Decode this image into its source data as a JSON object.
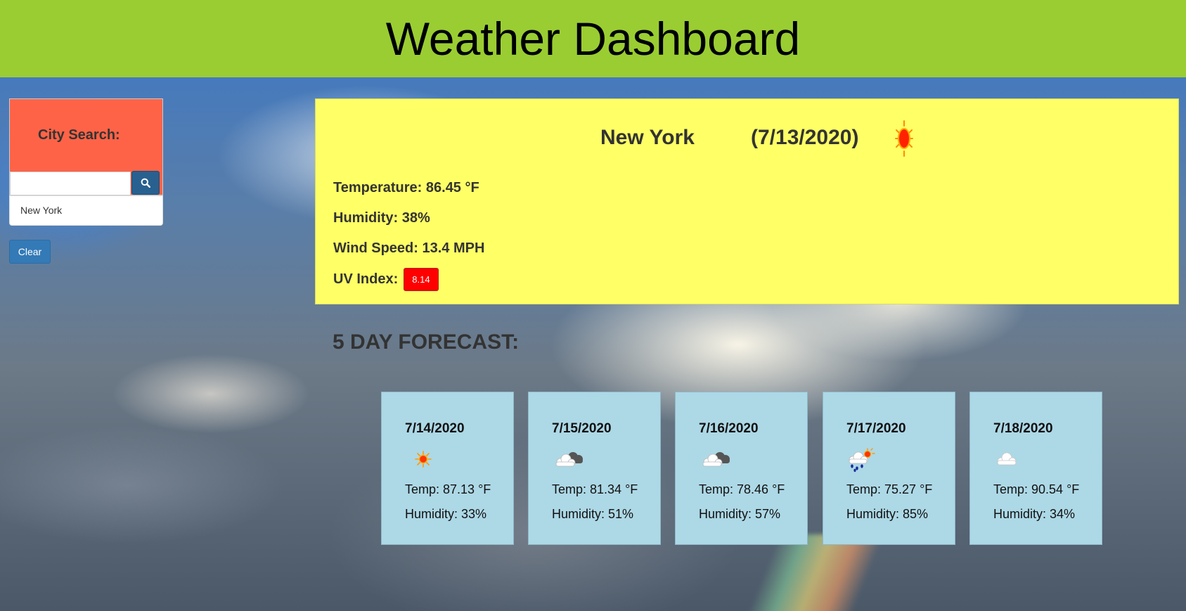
{
  "header": {
    "title": "Weather Dashboard"
  },
  "sidebar": {
    "search_label": "City Search:",
    "search_input_value": "",
    "search_button_icon": "search-icon",
    "history": [
      "New York"
    ],
    "clear_label": "Clear"
  },
  "current": {
    "city": "New York",
    "date": "(7/13/2020)",
    "icon": "sun-icon",
    "temperature": "Temperature: 86.45 °F",
    "humidity": "Humidity: 38%",
    "wind": "Wind Speed: 13.4 MPH",
    "uv_label": "UV Index:",
    "uv_value": "8.14",
    "uv_color": "#ff0000"
  },
  "forecast": {
    "heading": "5 DAY FORECAST:",
    "days": [
      {
        "date": "7/14/2020",
        "icon": "sun-icon",
        "temp": "Temp: 87.13 °F",
        "humidity": "Humidity: 33%"
      },
      {
        "date": "7/15/2020",
        "icon": "cloud-icon",
        "temp": "Temp: 81.34 °F",
        "humidity": "Humidity: 51%"
      },
      {
        "date": "7/16/2020",
        "icon": "cloud-icon",
        "temp": "Temp: 78.46 °F",
        "humidity": "Humidity: 57%"
      },
      {
        "date": "7/17/2020",
        "icon": "rain-sun-icon",
        "temp": "Temp: 75.27 °F",
        "humidity": "Humidity: 85%"
      },
      {
        "date": "7/18/2020",
        "icon": "light-cloud-icon",
        "temp": "Temp: 90.54 °F",
        "humidity": "Humidity: 34%"
      }
    ]
  },
  "colors": {
    "header_bg": "#9acd32",
    "search_panel_bg": "#ff6347",
    "current_card_bg": "#ffff66",
    "forecast_card_bg": "#add8e6",
    "primary_button": "#337ab7",
    "search_button": "#286090"
  }
}
